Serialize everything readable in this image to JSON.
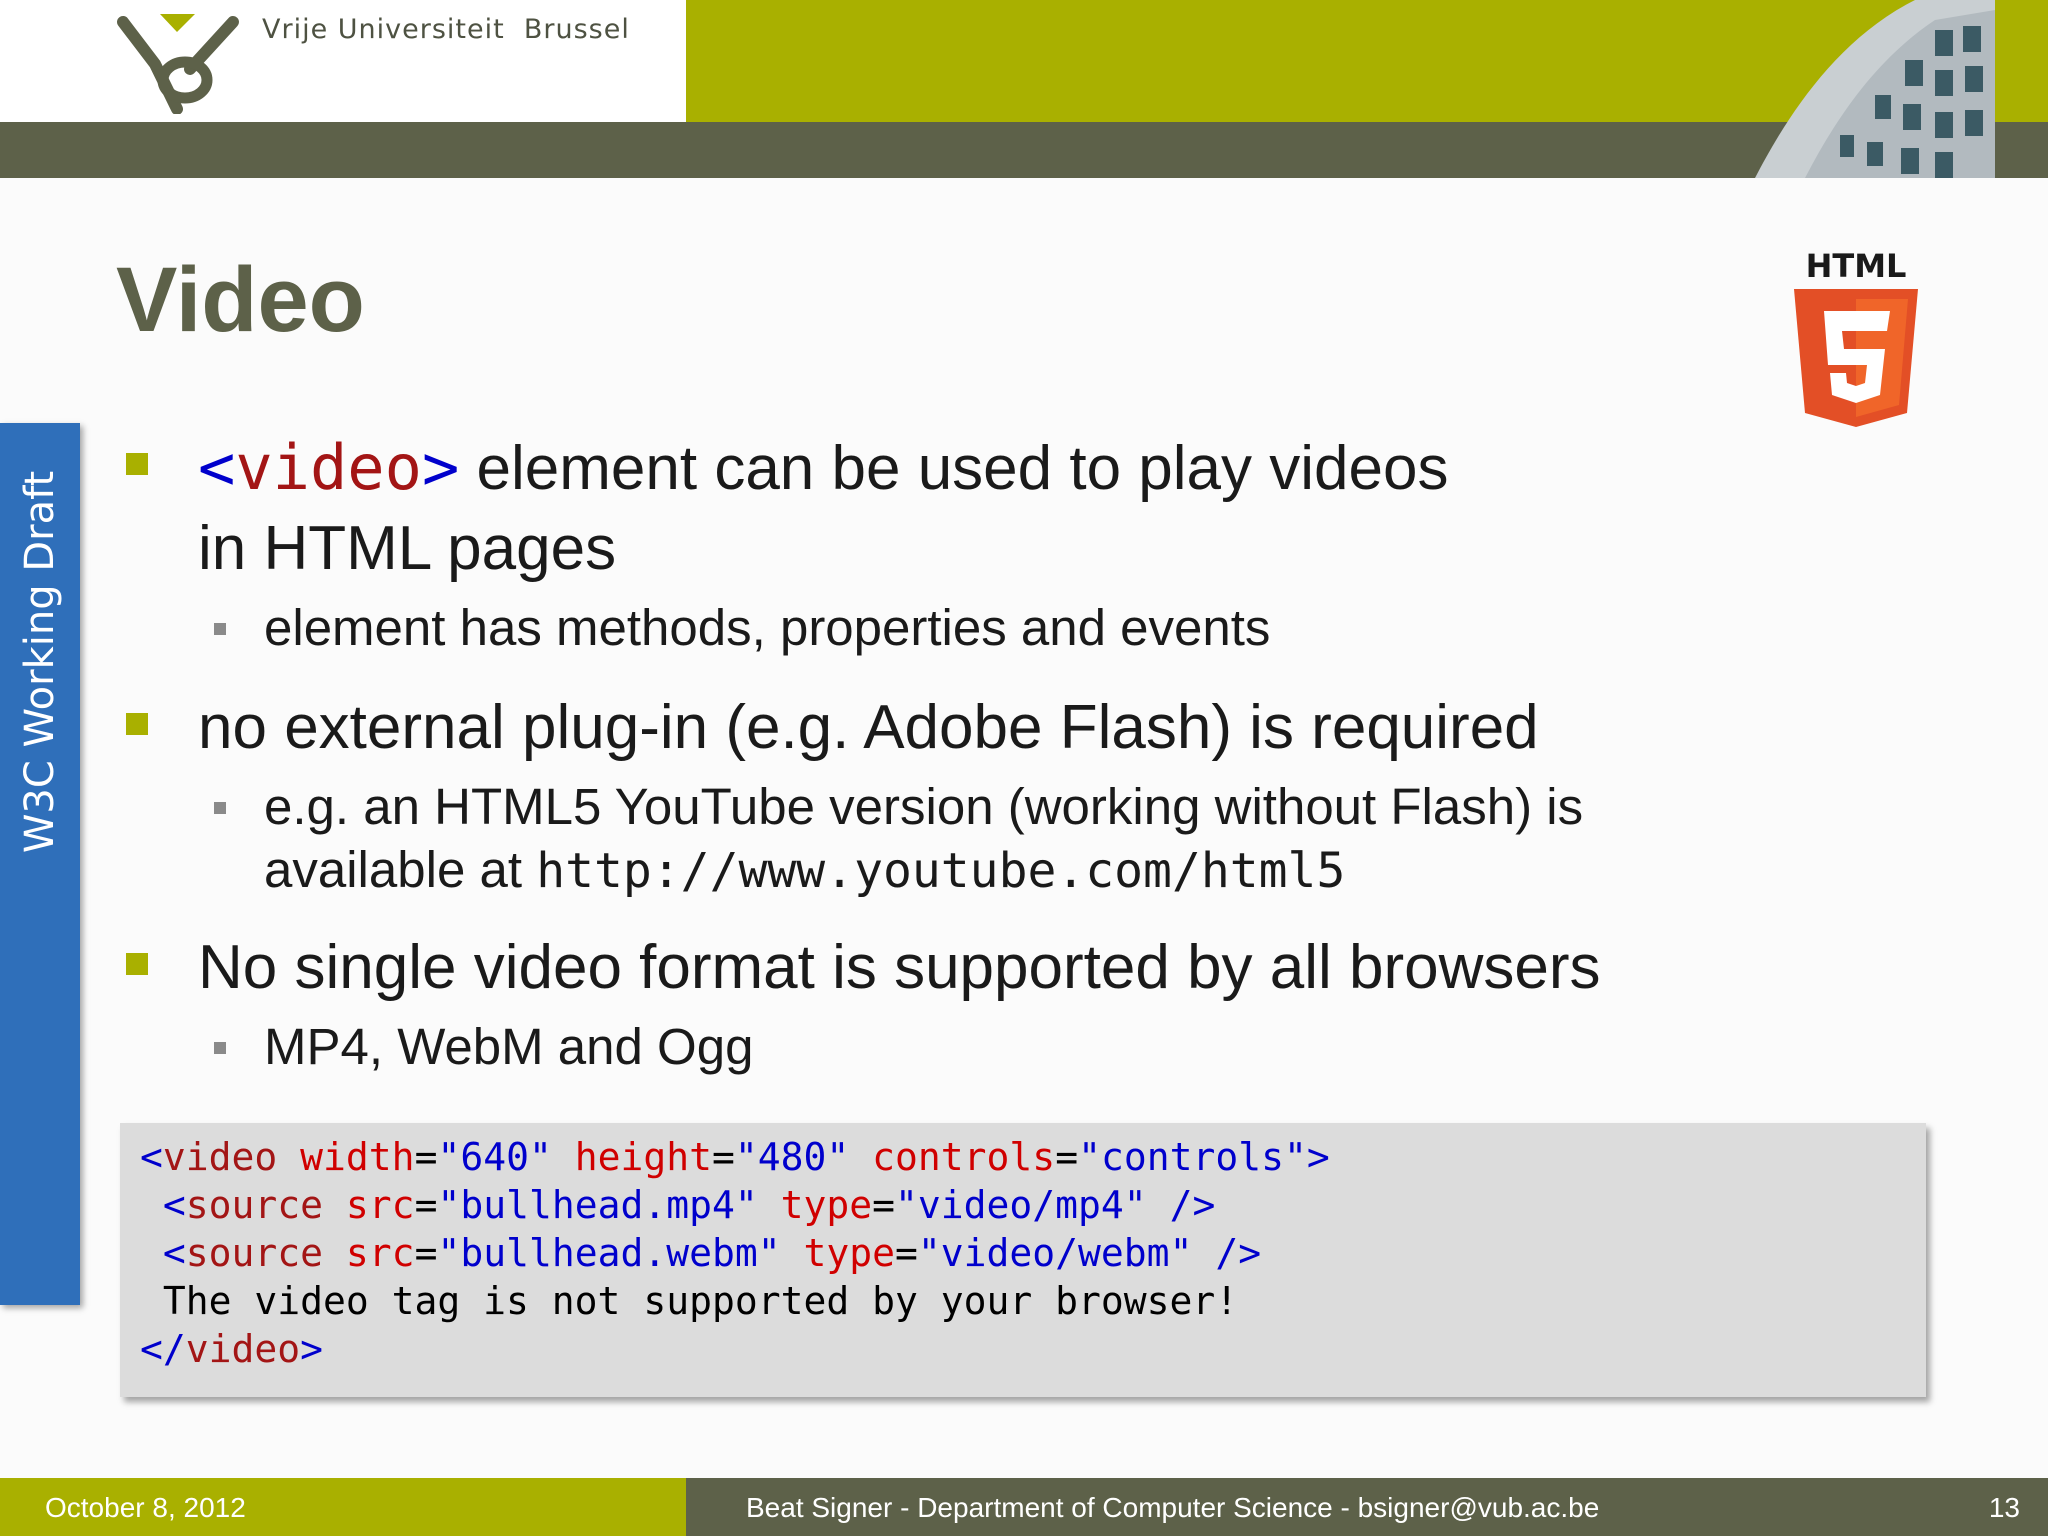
{
  "header": {
    "university": "Vrije Universiteit  Brussel"
  },
  "slide": {
    "title": "Video",
    "side_label": "W3C Working Draft",
    "bullets": [
      {
        "tag_open": "<",
        "tag_name": "video",
        "tag_close": ">",
        "text_line1": " element can be used to play videos",
        "text_line2": "in HTML pages",
        "sub": [
          "element has methods, properties and events"
        ]
      },
      {
        "text": "no external plug-in (e.g. Adobe Flash) is required",
        "sub_line1": "e.g. an HTML5 YouTube version (working without Flash) is",
        "sub_line2_prefix": "available at ",
        "sub_line2_url": "http://www.youtube.com/html5"
      },
      {
        "text": "No single video format is supported by all browsers",
        "sub": [
          "MP4, WebM and Ogg"
        ]
      }
    ]
  },
  "code": {
    "l1": {
      "t1": "<",
      "t2": "video",
      "t3": " width",
      "t4": "=",
      "t5": "\"640\"",
      "t6": " height",
      "t7": "=",
      "t8": "\"480\"",
      "t9": " controls",
      "t10": "=",
      "t11": "\"controls\">"
    },
    "l2": {
      "t1": " <",
      "t2": "source",
      "t3": " src",
      "t4": "=",
      "t5": "\"bullhead.mp4\"",
      "t6": " type",
      "t7": "=",
      "t8": "\"video/mp4\"",
      "t9": " />"
    },
    "l3": {
      "t1": " <",
      "t2": "source",
      "t3": " src",
      "t4": "=",
      "t5": "\"bullhead.webm\"",
      "t6": " type",
      "t7": "=",
      "t8": "\"video/webm\"",
      "t9": " />"
    },
    "l4": " The video tag is not supported by your browser!",
    "l5": {
      "t1": "</",
      "t2": "video",
      "t3": ">"
    }
  },
  "footer": {
    "date": "October 8, 2012",
    "author": "Beat Signer - Department of Computer Science - bsigner@vub.ac.be",
    "page": "13"
  },
  "logos": {
    "html5_label": "HTML",
    "html5_number": "5"
  },
  "colors": {
    "olive": "#a9b000",
    "dark_olive": "#5d6149",
    "side_tab": "#2f6fba",
    "html5_orange": "#e34f26"
  }
}
